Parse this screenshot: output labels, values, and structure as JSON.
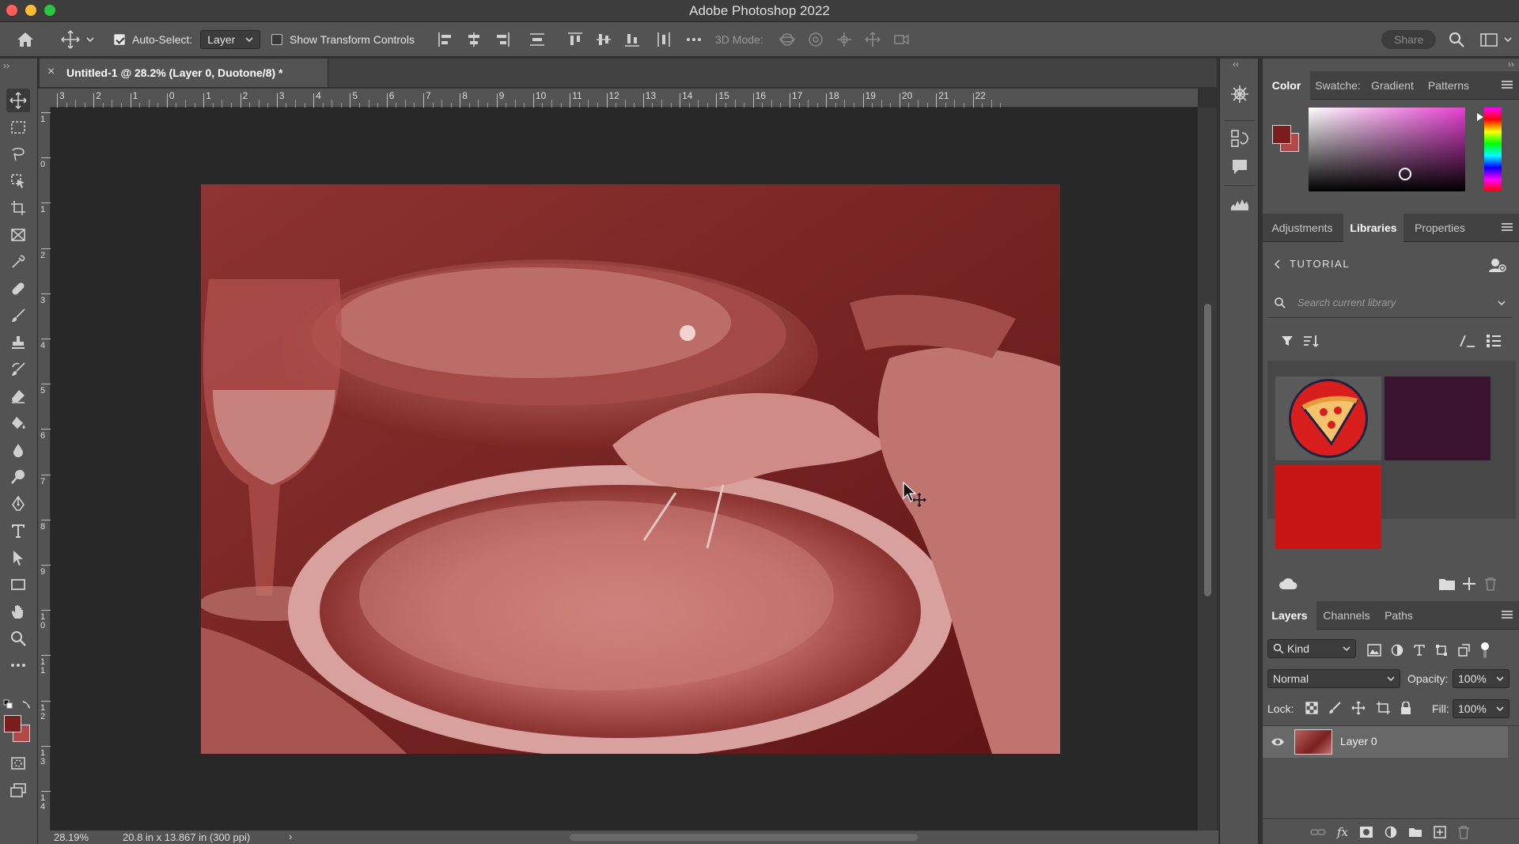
{
  "app": {
    "title": "Adobe Photoshop 2022"
  },
  "options": {
    "auto_select_label": "Auto-Select:",
    "auto_select_value": "Layer",
    "show_transform_label": "Show Transform Controls",
    "mode_3d_label": "3D Mode:",
    "share_label": "Share"
  },
  "document": {
    "tab_title": "Untitled-1 @ 28.2% (Layer 0, Duotone/8) *"
  },
  "ruler": {
    "top_labels": [
      "3",
      "2",
      "1",
      "0",
      "1",
      "2",
      "3",
      "4",
      "5",
      "6",
      "7",
      "8",
      "9",
      "10",
      "11",
      "12",
      "13",
      "14",
      "15",
      "16",
      "17",
      "18",
      "19",
      "20",
      "21",
      "22"
    ],
    "left_labels": [
      "1",
      "0",
      "1",
      "2",
      "3",
      "4",
      "5",
      "6",
      "7",
      "8",
      "9",
      "1 0",
      "1 1",
      "1 2",
      "1 3",
      "1 4"
    ]
  },
  "status": {
    "zoom": "28.19%",
    "doc_size": "20.8 in x 13.867 in (300 ppi)"
  },
  "color_panel": {
    "tabs": [
      "Color",
      "Swatche:",
      "Gradient",
      "Patterns"
    ],
    "foreground": "#7a1d1d",
    "background": "#b04a4a"
  },
  "libraries_panel": {
    "tabs": [
      "Adjustments",
      "Libraries",
      "Properties"
    ],
    "library_name": "TUTORIAL",
    "search_placeholder": "Search current library",
    "swatches": [
      "#3a1330",
      "#c81515"
    ]
  },
  "layers_panel": {
    "tabs": [
      "Layers",
      "Channels",
      "Paths"
    ],
    "kind_label": "Kind",
    "blend_mode": "Normal",
    "opacity_label": "Opacity:",
    "opacity_value": "100%",
    "lock_label": "Lock:",
    "fill_label": "Fill:",
    "fill_value": "100%",
    "layers": [
      {
        "name": "Layer 0",
        "visible": true
      }
    ]
  },
  "colors": {
    "accent_duotone": "#6e1a1a",
    "ui_bg": "#535353"
  }
}
